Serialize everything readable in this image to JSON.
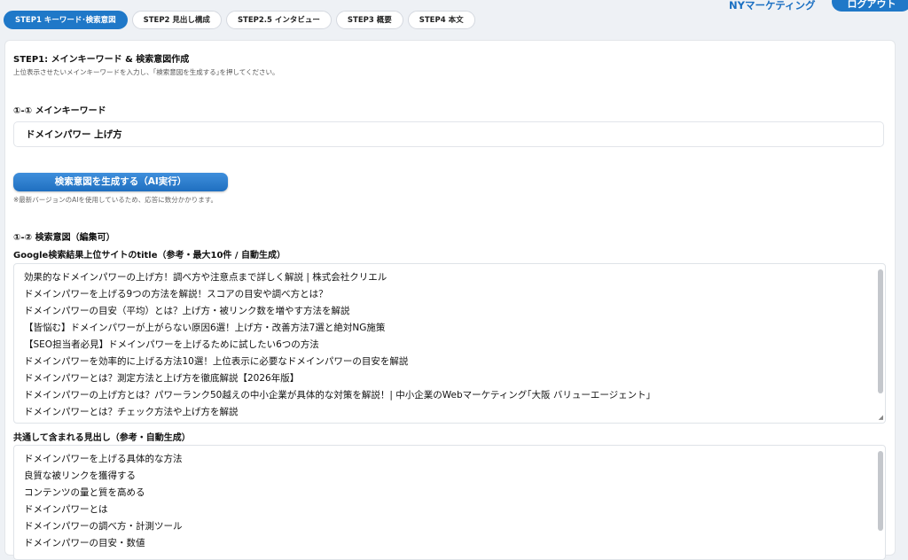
{
  "tabs": [
    {
      "label": "STEP1 キーワード･検索意図"
    },
    {
      "label": "STEP2 見出し構成"
    },
    {
      "label": "STEP2.5 インタビュー"
    },
    {
      "label": "STEP3 概要"
    },
    {
      "label": "STEP4 本文"
    }
  ],
  "header": {
    "brand": "NYマーケティング",
    "logout": "ログアウト"
  },
  "step1": {
    "title": "STEP1: メインキーワード & 検索意図作成",
    "subtitle": "上位表示させたいメインキーワードを入力し、｢検索意図を生成する｣を押してください。",
    "keyword_label": "①-① メインキーワード",
    "keyword_value": "ドメインパワー 上げ方",
    "generate_button": "検索意図を生成する（AI実行）",
    "note": "※最新バージョンのAIを使用しているため、応答に数分かかります。",
    "intent_label": "①-② 検索意図（編集可）",
    "titles_label": "Google検索結果上位サイトのtitle（参考・最大10件 / 自動生成）",
    "titles": [
      "効果的なドメインパワーの上げ方！調べ方や注意点まで詳しく解説 | 株式会社クリエル",
      "ドメインパワーを上げる9つの方法を解説！スコアの目安や調べ方とは？",
      "ドメインパワーの目安（平均）とは？上げ方・被リンク数を増やす方法を解説",
      "【皆悩む】ドメインパワーが上がらない原因6選！上げ方・改善方法7選と絶対NG施策",
      "【SEO担当者必見】ドメインパワーを上げるために試したい6つの方法",
      "ドメインパワーを効率的に上げる方法10選！上位表示に必要なドメインパワーの目安を解説",
      "ドメインパワーとは？測定方法と上げ方を徹底解説【2026年版】",
      "ドメインパワーの上げ方とは？パワーランク50越えの中小企業が具体的な対策を解説！| 中小企業のWebマーケティング｢大阪 バリューエージェント｣",
      "ドメインパワーとは？チェック方法や上げ方を解説"
    ],
    "headings_label": "共通して含まれる見出し（参考・自動生成）",
    "headings": [
      "ドメインパワーを上げる具体的な方法",
      "良質な被リンクを獲得する",
      "コンテンツの量と質を高める",
      "ドメインパワーとは",
      "ドメインパワーの調べ方・計測ツール",
      "ドメインパワーの目安・数値"
    ]
  }
}
